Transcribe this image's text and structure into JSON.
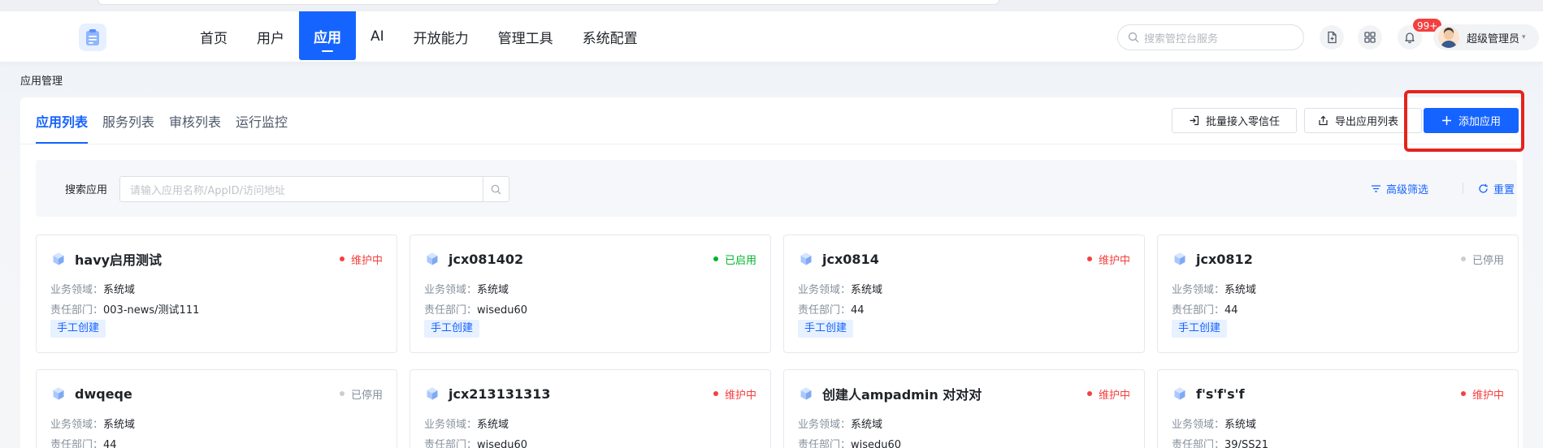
{
  "header": {
    "nav": [
      "首页",
      "用户",
      "应用",
      "AI",
      "开放能力",
      "管理工具",
      "系统配置"
    ],
    "active_nav": 2,
    "search_placeholder": "搜索管控台服务",
    "notification_badge": "99+",
    "user_name": "超级管理员",
    "user_caret": "▾"
  },
  "breadcrumb": "应用管理",
  "tabs": [
    "应用列表",
    "服务列表",
    "审核列表",
    "运行监控"
  ],
  "active_tab": 0,
  "actions": {
    "batch_label": "批量接入零信任",
    "export_label": "导出应用列表",
    "add_label": "添加应用"
  },
  "filter": {
    "label": "搜索应用",
    "placeholder": "请输入应用名称/AppID/访问地址",
    "advanced_label": "高级筛选",
    "reset_label": "重置"
  },
  "card_labels": {
    "domain_key": "业务领域：",
    "dept_key": "责任部门："
  },
  "colors": {
    "primary": "#1664ff",
    "status_maintenance": "#f53f3f",
    "status_enabled": "#00b42a",
    "status_disabled": "#86909c",
    "highlight_box": "#e5231d"
  },
  "apps": [
    {
      "name": "havy启用测试",
      "status": "维护中",
      "domain": "系统域",
      "dept": "003-news/测试111",
      "tag": "手工创建"
    },
    {
      "name": "jcx081402",
      "status": "已启用",
      "domain": "系统域",
      "dept": "wisedu60",
      "tag": "手工创建"
    },
    {
      "name": "jcx0814",
      "status": "维护中",
      "domain": "系统域",
      "dept": "44",
      "tag": "手工创建"
    },
    {
      "name": "jcx0812",
      "status": "已停用",
      "domain": "系统域",
      "dept": "44",
      "tag": "手工创建"
    },
    {
      "name": "dwqeqe",
      "status": "已停用",
      "domain": "系统域",
      "dept": "44",
      "tag": ""
    },
    {
      "name": "jcx213131313",
      "status": "维护中",
      "domain": "系统域",
      "dept": "wisedu60",
      "tag": ""
    },
    {
      "name": "创建人ampadmin 对对对",
      "status": "维护中",
      "domain": "系统域",
      "dept": "wisedu60",
      "tag": ""
    },
    {
      "name": "f's'f's'f",
      "status": "维护中",
      "domain": "系统域",
      "dept": "39/SS21",
      "tag": ""
    }
  ]
}
